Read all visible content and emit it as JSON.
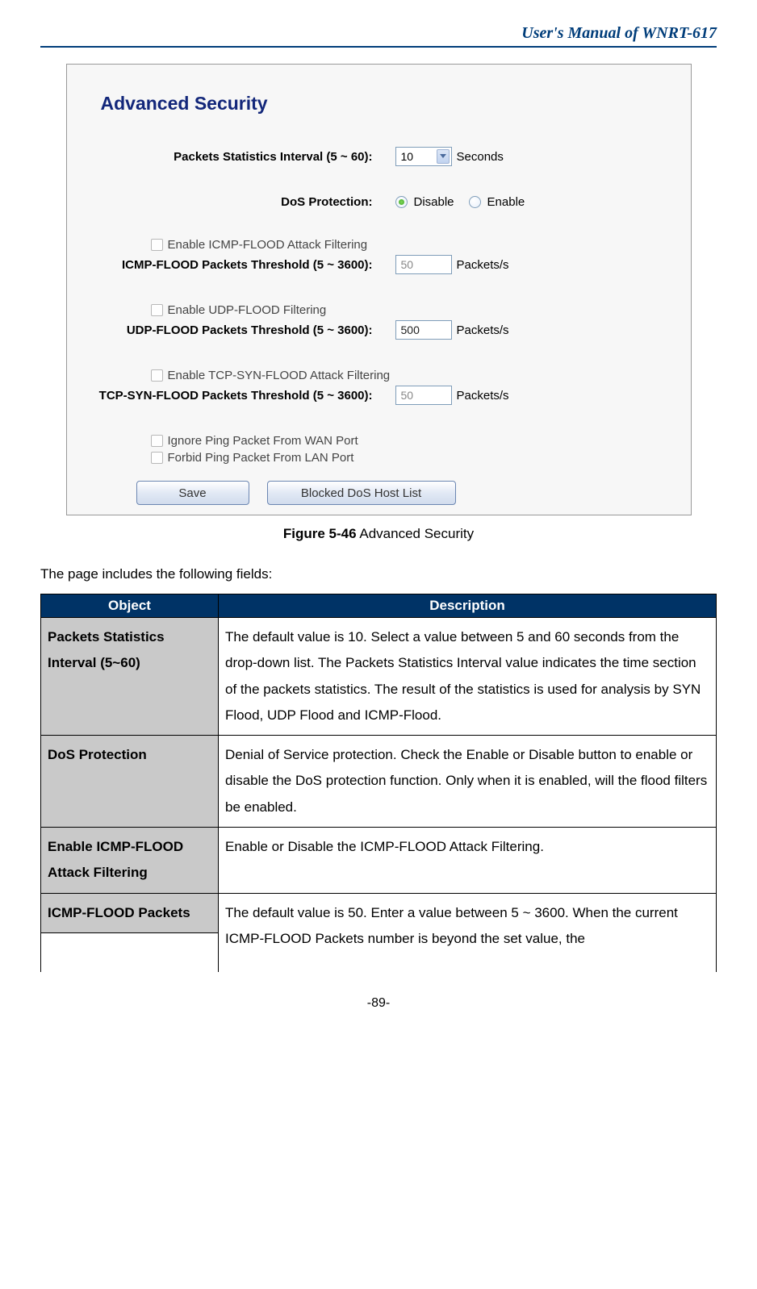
{
  "header": {
    "manual_title": "User's  Manual  of  WNRT-617"
  },
  "screenshot": {
    "title": "Advanced Security",
    "packets_interval": {
      "label": "Packets Statistics Interval (5 ~ 60):",
      "value": "10",
      "unit": "Seconds"
    },
    "dos": {
      "label": "DoS Protection:",
      "opt_disable": "Disable",
      "opt_enable": "Enable"
    },
    "icmp_enable": "Enable ICMP-FLOOD Attack Filtering",
    "icmp_thresh": {
      "label": "ICMP-FLOOD Packets Threshold (5 ~ 3600):",
      "value": "50",
      "unit": "Packets/s"
    },
    "udp_enable": "Enable UDP-FLOOD Filtering",
    "udp_thresh": {
      "label": "UDP-FLOOD Packets Threshold (5 ~ 3600):",
      "value": "500",
      "unit": "Packets/s"
    },
    "tcp_enable": "Enable TCP-SYN-FLOOD Attack Filtering",
    "tcp_thresh": {
      "label": "TCP-SYN-FLOOD Packets Threshold (5 ~ 3600):",
      "value": "50",
      "unit": "Packets/s"
    },
    "ignore_ping_wan": "Ignore Ping Packet From WAN Port",
    "forbid_ping_lan": "Forbid Ping Packet From LAN Port",
    "btn_save": "Save",
    "btn_blocked": "Blocked DoS Host List"
  },
  "caption": {
    "fig": "Figure 5-46",
    "text": "  Advanced Security"
  },
  "intro": "The page includes the following fields:",
  "table": {
    "h_object": "Object",
    "h_desc": "Description",
    "rows": [
      {
        "obj": "Packets Statistics Interval (5~60)",
        "desc": "The default value is 10. Select a value between 5 and 60 seconds from the drop-down list. The Packets Statistics Interval value indicates the time section of the packets statistics. The result of the statistics is used for analysis by SYN Flood, UDP Flood and ICMP-Flood."
      },
      {
        "obj": "DoS Protection",
        "desc": "Denial of Service protection. Check the Enable or Disable button to enable or disable the DoS protection function. Only when it is enabled, will the flood filters be enabled."
      },
      {
        "obj": "Enable ICMP-FLOOD Attack Filtering",
        "desc": "Enable or Disable the ICMP-FLOOD Attack Filtering."
      },
      {
        "obj": "ICMP-FLOOD Packets",
        "desc": "The default value is 50. Enter a value between 5 ~ 3600. When the current ICMP-FLOOD Packets number is beyond the set value, the"
      }
    ]
  },
  "page_num": "-89-"
}
